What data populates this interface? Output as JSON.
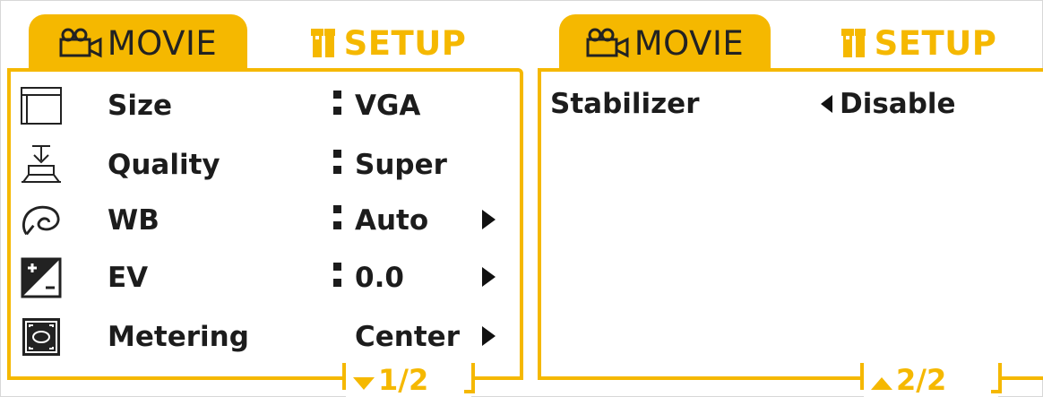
{
  "colors": {
    "accent": "#f5b800",
    "text": "#1c1c1c",
    "background": "#ffffff"
  },
  "left_panel": {
    "tabs": [
      {
        "label": "MOVIE",
        "icon": "movie-camera-icon",
        "active": true
      },
      {
        "label": "SETUP",
        "icon": "tools-icon",
        "active": false
      }
    ],
    "rows": [
      {
        "icon": "image-size-icon",
        "label": "Size",
        "value": "VGA",
        "has_colon": true,
        "has_arrow": false
      },
      {
        "icon": "quality-icon",
        "label": "Quality",
        "value": "Super",
        "has_colon": true,
        "has_arrow": false
      },
      {
        "icon": "white-balance-icon",
        "label": "WB",
        "value": "Auto",
        "has_colon": true,
        "has_arrow": true
      },
      {
        "icon": "exposure-value-icon",
        "label": "EV",
        "value": "0.0",
        "has_colon": true,
        "has_arrow": true
      },
      {
        "icon": "metering-icon",
        "label": "Metering",
        "value": "Center",
        "has_colon": false,
        "has_arrow": true
      }
    ],
    "page_indicator": "1/2"
  },
  "right_panel": {
    "tabs": [
      {
        "label": "MOVIE",
        "icon": "movie-camera-icon",
        "active": true
      },
      {
        "label": "SETUP",
        "icon": "tools-icon",
        "active": false
      }
    ],
    "rows": [
      {
        "label": "Stabilizer",
        "value": "Disable"
      }
    ],
    "page_indicator": "2/2"
  }
}
